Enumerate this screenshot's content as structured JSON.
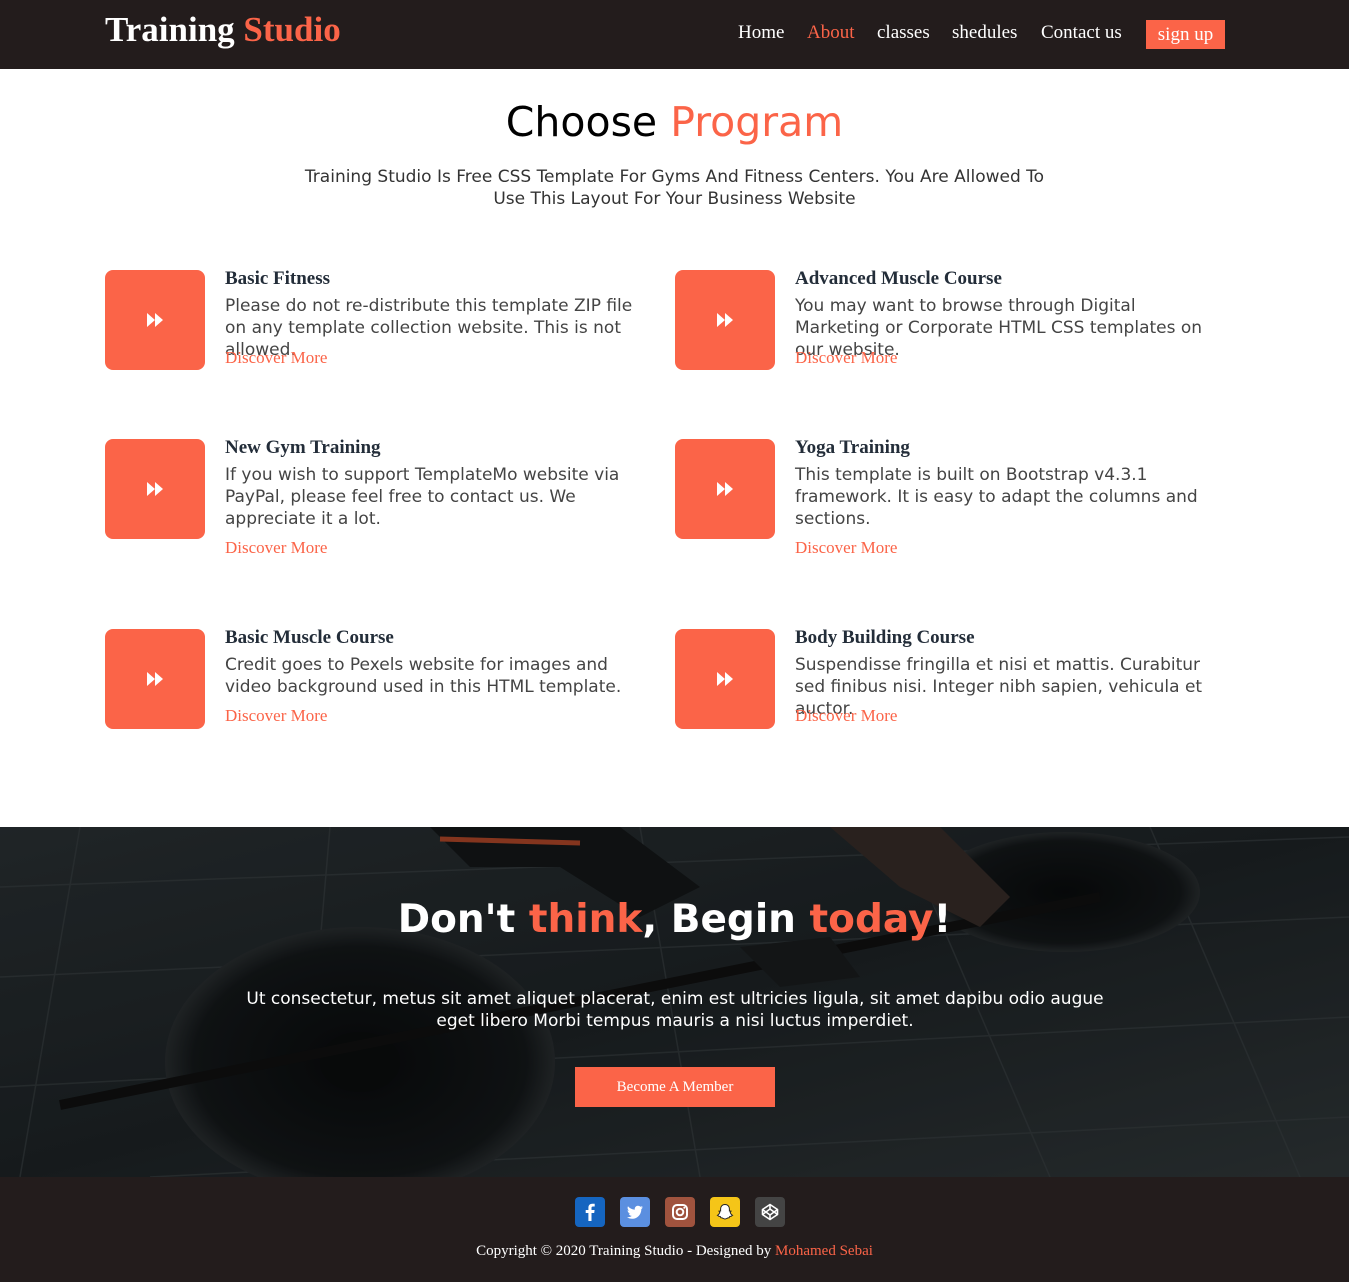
{
  "header": {
    "logo_part1": "Training",
    "logo_part2": "Studio",
    "nav": [
      "Home",
      "About",
      "classes",
      "shedules",
      "Contact us"
    ],
    "active_nav": "About",
    "signup_label": "sign up"
  },
  "program": {
    "title_part1": "Choose",
    "title_part2": "Program",
    "subtitle": "Training Studio Is Free CSS Template For Gyms And Fitness Centers. You Are Allowed To Use This Layout For Your Business Website",
    "link_label": "Discover More",
    "icon": "fast-forward-icon",
    "cards": [
      {
        "title": "Basic Fitness",
        "text": "Please do not re-distribute this template ZIP file on any template collection website. This is not allowed."
      },
      {
        "title": "Advanced Muscle Course",
        "text": "You may want to browse through Digital Marketing or Corporate HTML CSS templates on our website."
      },
      {
        "title": "New Gym Training",
        "text": "If you wish to support TemplateMo website via PayPal, please feel free to contact us. We appreciate it a lot."
      },
      {
        "title": "Yoga Training",
        "text": "This template is built on Bootstrap v4.3.1 framework. It is easy to adapt the columns and sections."
      },
      {
        "title": "Basic Muscle Course",
        "text": "Credit goes to Pexels website for images and video background used in this HTML template."
      },
      {
        "title": "Body Building Course",
        "text": "Suspendisse fringilla et nisi et mattis. Curabitur sed finibus nisi. Integer nibh sapien, vehicula et auctor."
      }
    ]
  },
  "banner": {
    "title_w1": "Don't",
    "title_w2": "think",
    "title_w3": ", Begin",
    "title_w4": "today",
    "title_w5": "!",
    "text": "Ut consectetur, metus sit amet aliquet placerat, enim est ultricies ligula, sit amet dapibu odio augue eget libero Morbi tempus mauris a nisi luctus imperdiet.",
    "button_label": "Become A Member"
  },
  "footer": {
    "social": [
      "facebook-icon",
      "twitter-icon",
      "instagram-icon",
      "snapchat-icon",
      "codepen-icon"
    ],
    "copyright_text": "Copyright © 2020 Training Studio - Designed by",
    "author": "Mohamed Sebai"
  },
  "colors": {
    "accent": "#fb6448",
    "dark": "#231c1c",
    "facebook": "#1565c0",
    "twitter": "#5b8fe0",
    "instagram": "#a0533e",
    "snapchat": "#f5c518",
    "codepen": "#444444"
  }
}
